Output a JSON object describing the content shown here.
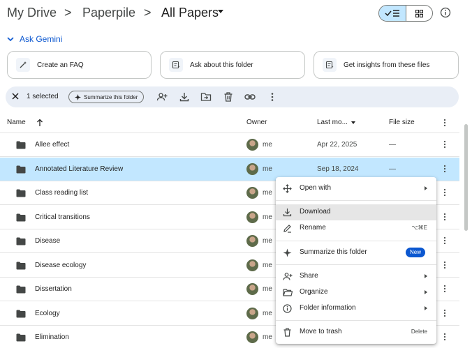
{
  "breadcrumb": {
    "items": [
      "My Drive",
      "Paperpile",
      "All Papers"
    ],
    "separator": ">"
  },
  "gemini": {
    "label": "Ask Gemini"
  },
  "suggestions": [
    "Create an FAQ",
    "Ask about this folder",
    "Get insights from these files"
  ],
  "selection_bar": {
    "count": "1 selected",
    "summarize": "Summarize this folder"
  },
  "table": {
    "headers": {
      "name": "Name",
      "owner": "Owner",
      "modified": "Last mo...",
      "size": "File size"
    },
    "rows": [
      {
        "name": "Allee effect",
        "owner": "me",
        "date": "Apr 22, 2025",
        "size": "—"
      },
      {
        "name": "Annotated Literature Review",
        "owner": "me",
        "date": "Sep 18, 2024",
        "size": "—",
        "selected": true
      },
      {
        "name": "Class reading list",
        "owner": "me",
        "date": "",
        "size": ""
      },
      {
        "name": "Critical transitions",
        "owner": "me",
        "date": "",
        "size": ""
      },
      {
        "name": "Disease",
        "owner": "me",
        "date": "",
        "size": ""
      },
      {
        "name": "Disease ecology",
        "owner": "me",
        "date": "",
        "size": ""
      },
      {
        "name": "Dissertation",
        "owner": "me",
        "date": "",
        "size": ""
      },
      {
        "name": "Ecology",
        "owner": "me",
        "date": "",
        "size": ""
      },
      {
        "name": "Elimination",
        "owner": "me",
        "date": "",
        "size": ""
      }
    ]
  },
  "context_menu": {
    "open_with": "Open with",
    "download": "Download",
    "rename": "Rename",
    "rename_shortcut": "⌥⌘E",
    "summarize": "Summarize this folder",
    "new_badge": "New",
    "share": "Share",
    "organize": "Organize",
    "folder_info": "Folder information",
    "trash": "Move to trash",
    "trash_shortcut": "Delete"
  },
  "colors": {
    "accent": "#0b57d0",
    "selected_row": "#c2e7ff",
    "selection_bar": "#e9eef6"
  }
}
